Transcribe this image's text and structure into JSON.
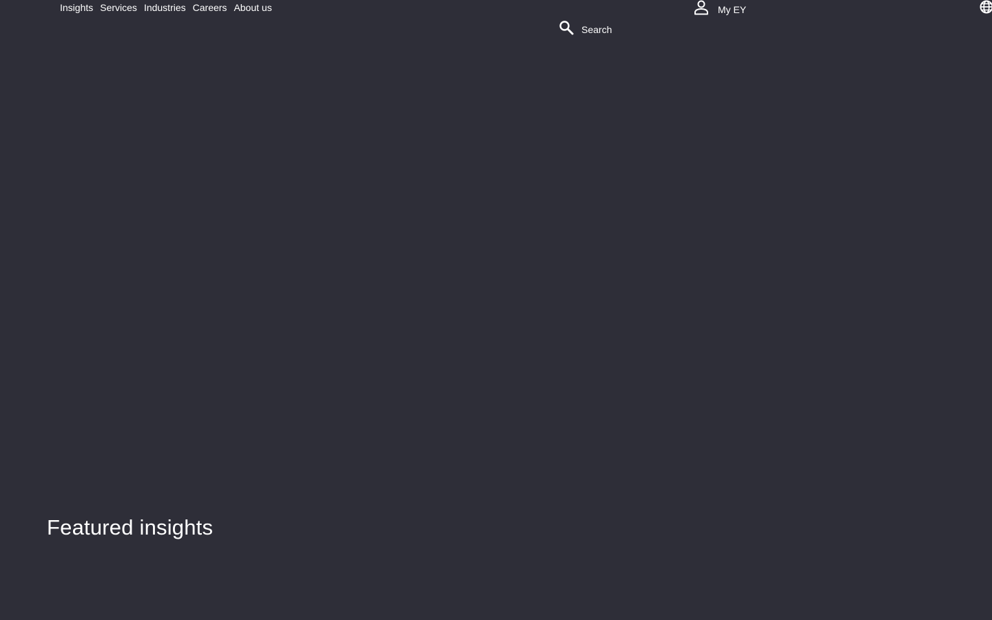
{
  "header": {
    "nav_items": [
      {
        "label": "Insights"
      },
      {
        "label": "Services"
      },
      {
        "label": "Industries"
      },
      {
        "label": "Careers"
      },
      {
        "label": "About us"
      }
    ],
    "search": {
      "label": "Search",
      "icon": "search-icon"
    },
    "account": {
      "label": "My EY",
      "icon": "user-icon"
    },
    "language": {
      "icon": "globe-icon"
    }
  },
  "main": {
    "section_title": "Featured insights"
  },
  "colors": {
    "background": "#2e2e38",
    "text": "#ffffff"
  }
}
